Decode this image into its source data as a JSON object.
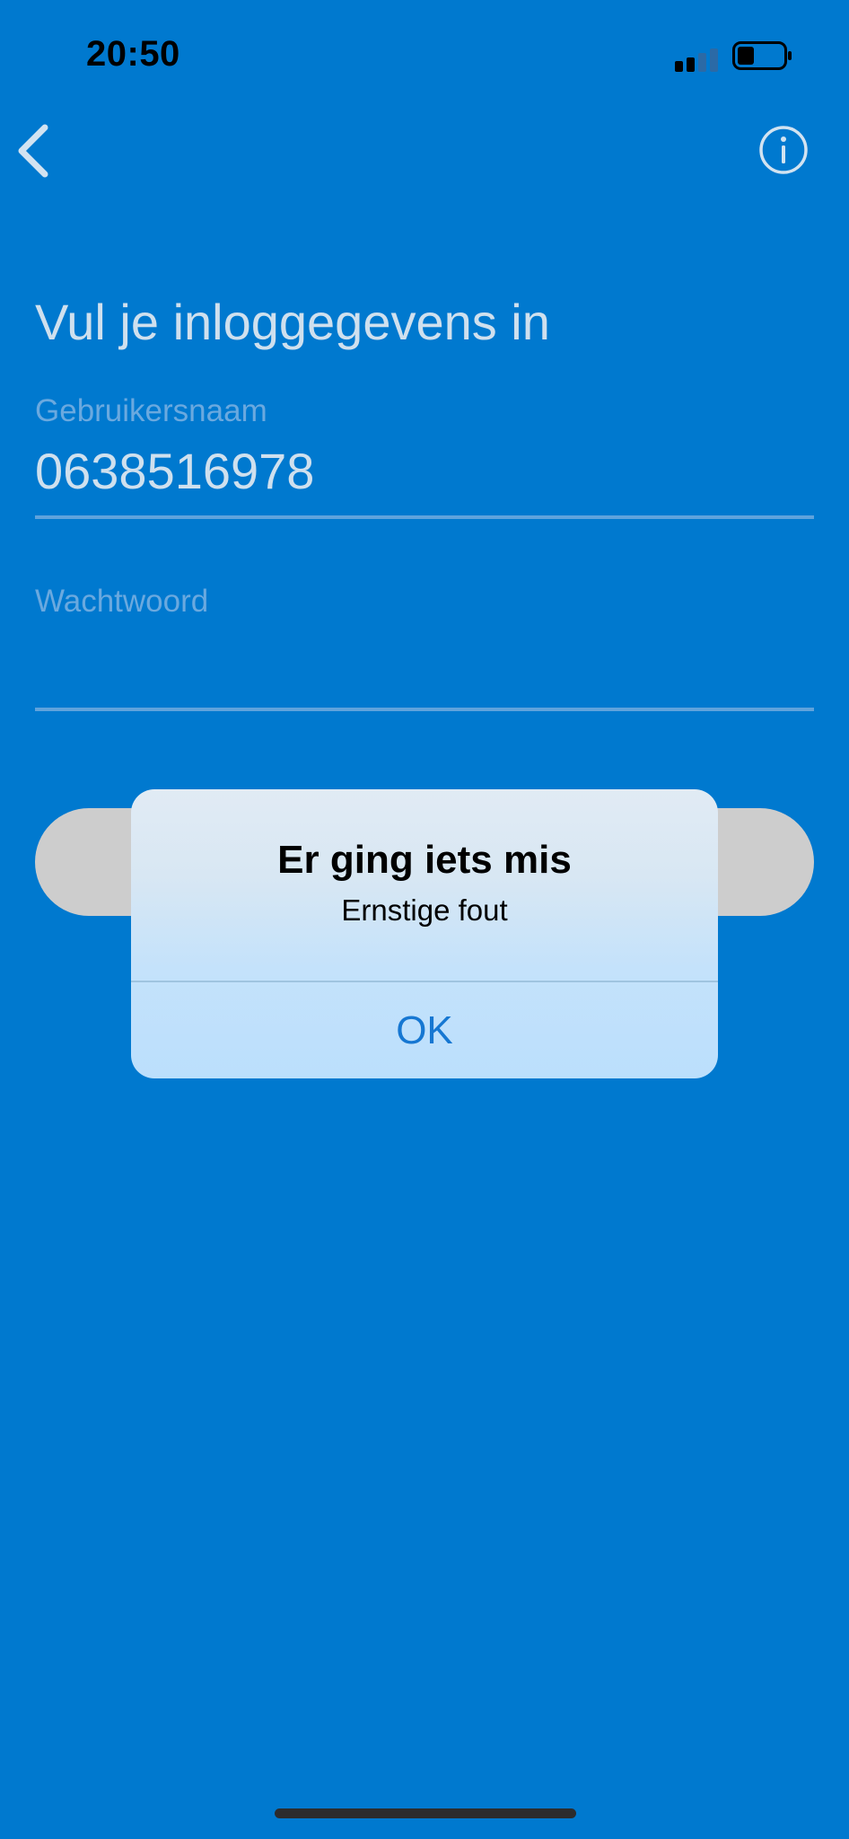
{
  "status_bar": {
    "time": "20:50"
  },
  "nav": {
    "back_icon": "chevron-left-icon",
    "info_icon": "info-circle-icon"
  },
  "form": {
    "title": "Vul je inloggegevens in",
    "username_label": "Gebruikersnaam",
    "username_value": "0638516978",
    "password_label": "Wachtwoord",
    "password_value": ""
  },
  "alert": {
    "title": "Er ging iets mis",
    "message": "Ernstige fout",
    "ok_label": "OK"
  },
  "colors": {
    "background": "#0079cf",
    "text_light": "#cfe0ee",
    "label_muted": "#6aa9df",
    "button_disabled": "#cdcdcd",
    "alert_action": "#1677d2"
  }
}
